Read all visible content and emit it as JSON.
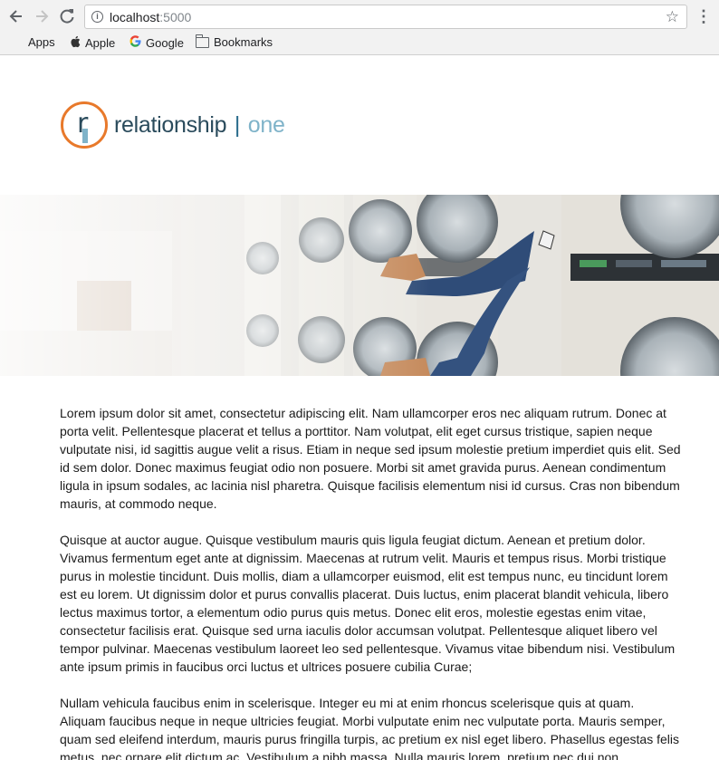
{
  "browser": {
    "url_host": "localhost",
    "url_port": ":5000",
    "bookmarks": [
      {
        "label": "Apps",
        "icon": "apps-grid-icon"
      },
      {
        "label": "Apple",
        "icon": "apple-icon"
      },
      {
        "label": "Google",
        "icon": "google-icon"
      },
      {
        "label": "Bookmarks",
        "icon": "folder-icon"
      }
    ]
  },
  "logo": {
    "mark_letter": "r",
    "name_main": "relationship",
    "separator": "|",
    "name_suffix": "one",
    "colors": {
      "ring": "#e8792b",
      "dark": "#2a4b5c",
      "light": "#7fb3c9"
    }
  },
  "hero": {
    "description_icon": "laundromat-photo"
  },
  "content": {
    "paragraphs": [
      "Lorem ipsum dolor sit amet, consectetur adipiscing elit. Nam ullamcorper eros nec aliquam rutrum. Donec at porta velit. Pellentesque placerat et tellus a porttitor. Nam volutpat, elit eget cursus tristique, sapien neque vulputate nisi, id sagittis augue velit a risus. Etiam in neque sed ipsum molestie pretium imperdiet quis elit. Sed id sem dolor. Donec maximus feugiat odio non posuere. Morbi sit amet gravida purus. Aenean condimentum ligula in ipsum sodales, ac lacinia nisl pharetra. Quisque facilisis elementum nisi id cursus. Cras non bibendum mauris, at commodo neque.",
      "Quisque at auctor augue. Quisque vestibulum mauris quis ligula feugiat dictum. Aenean et pretium dolor. Vivamus fermentum eget ante at dignissim. Maecenas at rutrum velit. Mauris et tempus risus. Morbi tristique purus in molestie tincidunt. Duis mollis, diam a ullamcorper euismod, elit est tempus nunc, eu tincidunt lorem est eu lorem. Ut dignissim dolor et purus convallis placerat. Duis luctus, enim placerat blandit vehicula, libero lectus maximus tortor, a elementum odio purus quis metus. Donec elit eros, molestie egestas enim vitae, consectetur facilisis erat. Quisque sed urna iaculis dolor accumsan volutpat. Pellentesque aliquet libero vel tempor pulvinar. Maecenas vestibulum laoreet leo sed pellentesque. Vivamus vitae bibendum nisi. Vestibulum ante ipsum primis in faucibus orci luctus et ultrices posuere cubilia Curae;",
      "Nullam vehicula faucibus enim in scelerisque. Integer eu mi at enim rhoncus scelerisque quis at quam. Aliquam faucibus neque in neque ultricies feugiat. Morbi vulputate enim nec vulputate porta. Mauris semper, quam sed eleifend interdum, mauris purus fringilla turpis, ac pretium ex nisl eget libero. Phasellus egestas felis metus, nec ornare elit dictum ac. Vestibulum a nibh massa. Nulla mauris lorem, pretium nec dui non,"
    ]
  }
}
